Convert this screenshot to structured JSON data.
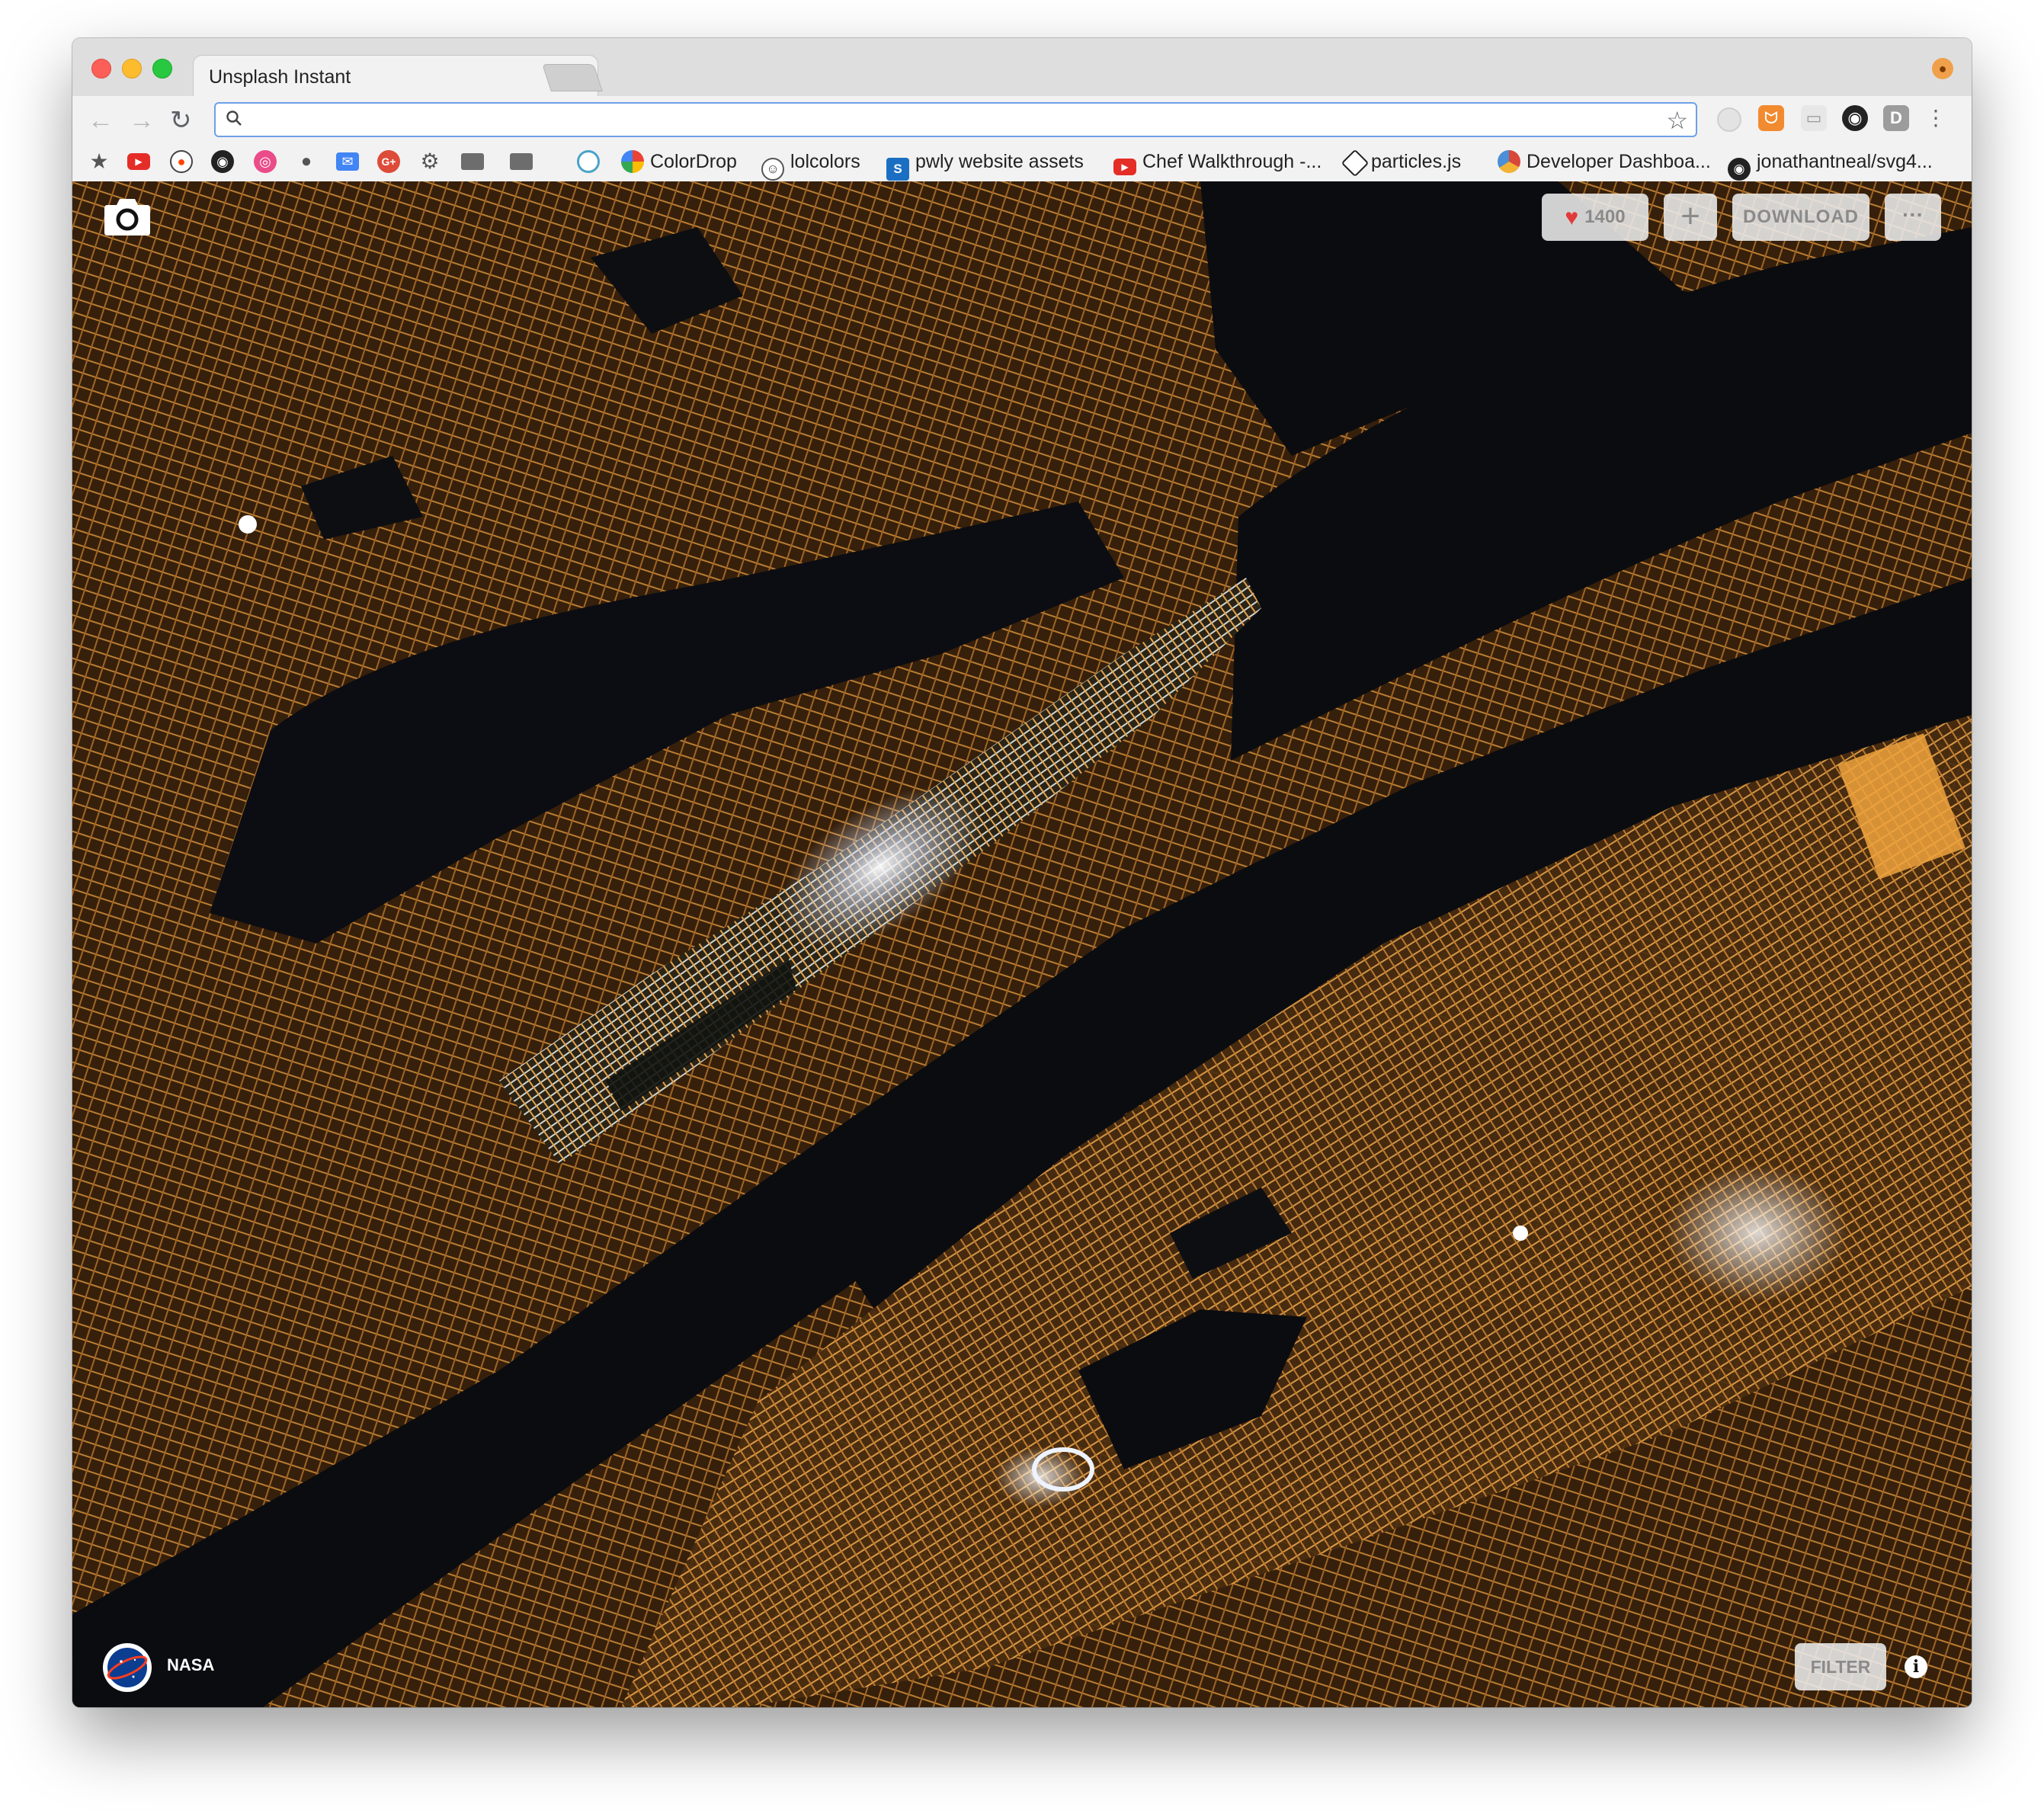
{
  "browser": {
    "tab_title": "Unsplash Instant",
    "tab_close_icon": "close-icon",
    "address_value": "",
    "bookmarks": [
      {
        "label": "ColorDrop",
        "icon": "colordrop-icon",
        "color": "#e9463b"
      },
      {
        "label": "lolcolors",
        "icon": "lolcolors-icon",
        "color": "#ffffff"
      },
      {
        "label": "pwly website assets",
        "icon": "sharepoint-icon",
        "color": "#1b6fc3"
      },
      {
        "label": "Chef Walkthrough -...",
        "icon": "youtube-icon",
        "color": "#e52d27"
      },
      {
        "label": "particles.js",
        "icon": "codepen-icon",
        "color": "#ffffff"
      },
      {
        "label": "Developer Dashboa...",
        "icon": "rainbow-icon",
        "color": "#d7473a"
      },
      {
        "label": "jonathantneal/svg4...",
        "icon": "github-icon",
        "color": "#222222"
      }
    ],
    "bookmark_icons": [
      "star-icon",
      "youtube-icon",
      "reddit-icon",
      "github-icon",
      "dribbble-icon",
      "apple-icon",
      "inbox-icon",
      "google-plus-icon",
      "gear-icon",
      "folder-icon",
      "folder-icon",
      "chrome-icon"
    ]
  },
  "photo": {
    "likes": "1400",
    "download_label": "DOWNLOAD",
    "add_label": "+",
    "more_label": "···",
    "author_name": "NASA",
    "filter_label": "FILTER",
    "info_label": "i",
    "accent_orange": "#e19a43",
    "heart_color": "#e2393a"
  }
}
